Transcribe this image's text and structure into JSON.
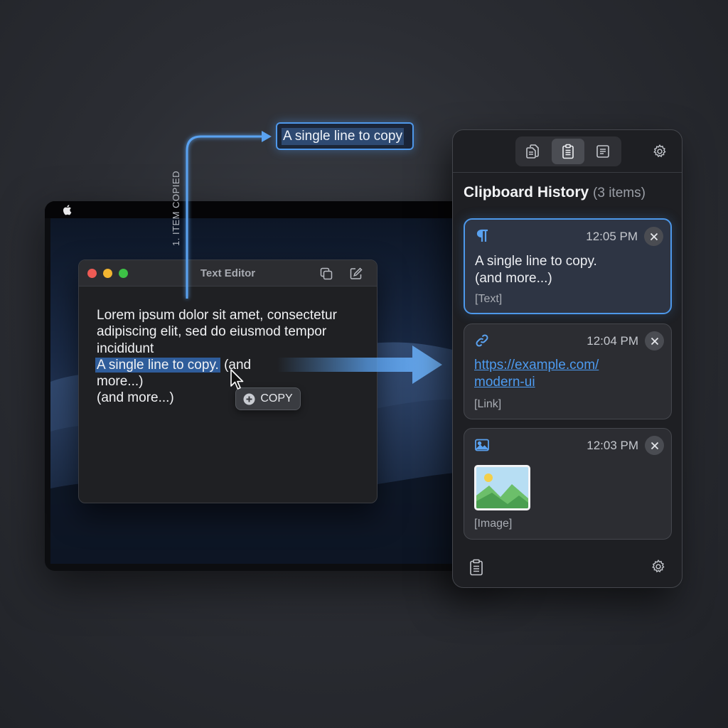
{
  "annotation": {
    "step_label": "1. ITEM COPIED",
    "copied_chip": "A single line to copy"
  },
  "editor": {
    "title": "Text Editor",
    "lines": [
      "Lorem ipsum dolor sit amet, consectetur",
      "adipiscing elit, sed do eiusmod tempor",
      "incididunt"
    ],
    "selected_text": "A single line to copy.",
    "after_selection": " (and",
    "line_more": "more...)",
    "line_more2": "(and more...)",
    "copy_button": "COPY"
  },
  "panel": {
    "title": "Clipboard History",
    "count": "(3 items)",
    "items": [
      {
        "time": "12:05 PM",
        "line1": "A single line to copy.",
        "line2": "(and more...)",
        "type": "[Text]",
        "icon": "paragraph-icon"
      },
      {
        "time": "12:04 PM",
        "line1": "https://example.com/",
        "line2": "modern-ui",
        "type": "[Link]",
        "icon": "link-icon"
      },
      {
        "time": "12:03 PM",
        "type": "[Image]",
        "icon": "image-icon"
      }
    ]
  },
  "colors": {
    "accent": "#4d98ea",
    "selection": "#2f5d9b",
    "panel_bg": "#1e1f23",
    "card_bg": "#2c2d32"
  }
}
